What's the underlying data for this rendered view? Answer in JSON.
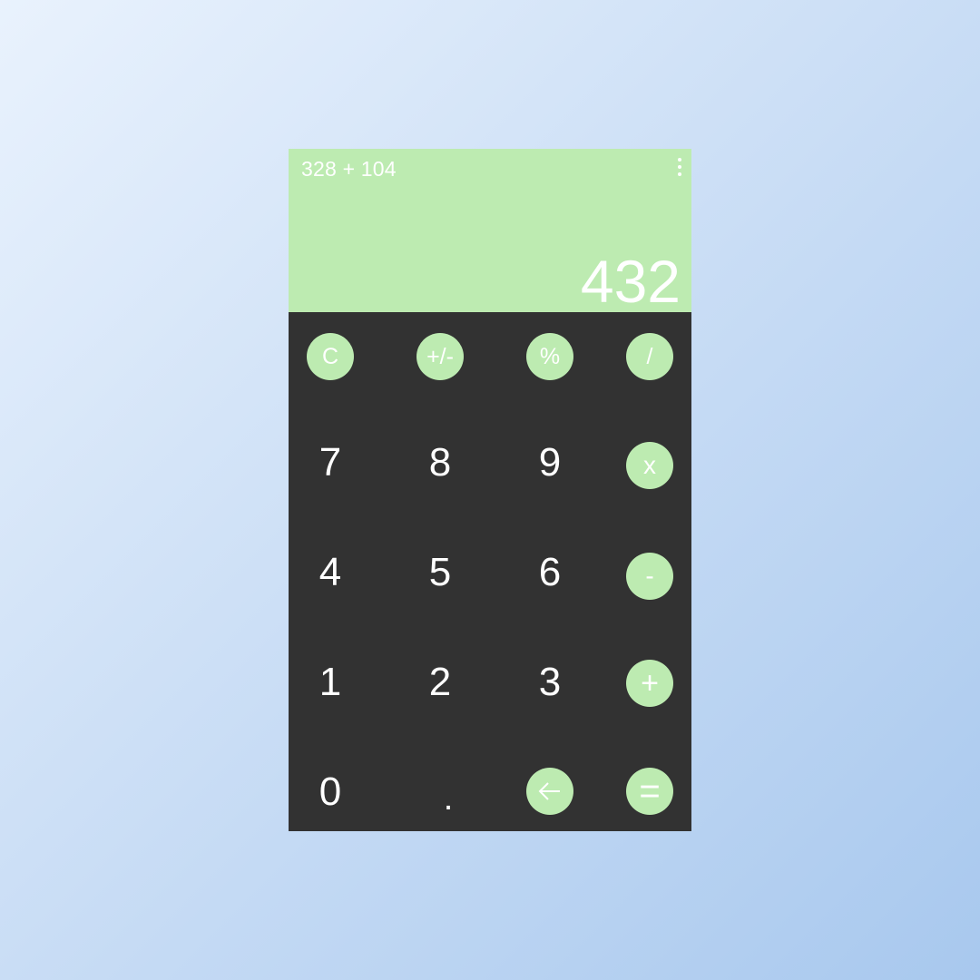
{
  "display": {
    "expression": "328 + 104",
    "result": "432",
    "menu_icon": "more-vertical-icon"
  },
  "keys": {
    "clear": "C",
    "sign": "+/-",
    "percent": "%",
    "divide": "/",
    "seven": "7",
    "eight": "8",
    "nine": "9",
    "multiply": "x",
    "four": "4",
    "five": "5",
    "six": "6",
    "subtract": "-",
    "one": "1",
    "two": "2",
    "three": "3",
    "add": "+",
    "zero": "0",
    "decimal": ".",
    "backspace_icon": "arrow-left-icon",
    "equals": "="
  },
  "colors": {
    "accent": "#bdebb1",
    "keypad_background": "#323232",
    "text": "#ffffff"
  }
}
